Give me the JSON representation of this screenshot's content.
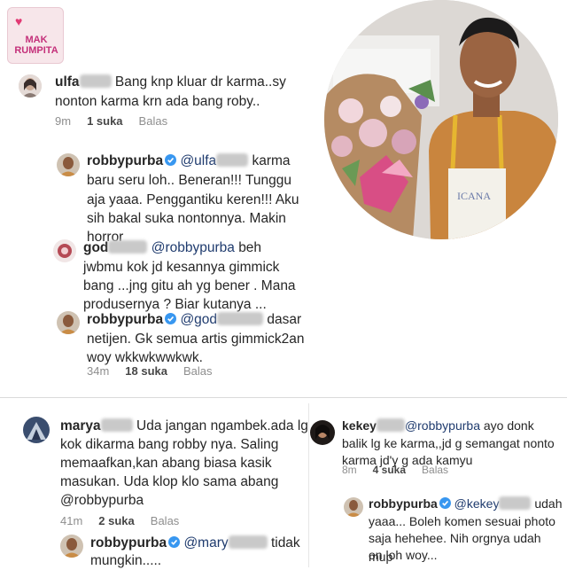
{
  "logo": {
    "text": "MAK RUMPITA"
  },
  "comments": {
    "ulfa": {
      "username": "ulfa",
      "text_1": "Bang knp kluar dr karma..sy",
      "text_2": "nonton karma krn ada bang roby..",
      "time": "9m",
      "likes": "1 suka",
      "reply": "Balas"
    },
    "robby1": {
      "username": "robbypurba",
      "mention": "@ulfa",
      "line1_tail": "karma",
      "line2": "baru seru loh.. Beneran!!! Tunggu",
      "line3": "aja yaaa. Penggantiku keren!!! Aku",
      "line4": "sih bakal suka nontonnya. Makin",
      "line5": "horror"
    },
    "god": {
      "username": "god",
      "mention": "@robbypurba",
      "line1_tail": "beh",
      "line2": "jwbmu kok jd kesannya gimmick",
      "line3": "bang ...jng gitu ah yg bener . Mana",
      "line4": "produsernya ? Biar kutanya ..."
    },
    "robby2": {
      "username": "robbypurba",
      "mention": "@god",
      "line1_tail": "dasar",
      "line2": "netijen. Gk semua artis gimmick2an",
      "line3": "woy wkkwkwwkwk.",
      "time": "34m",
      "likes": "18 suka",
      "reply": "Balas"
    },
    "marya": {
      "username": "marya",
      "text_1": "Uda jangan ngambek.ada lg",
      "line2": "kok dikarma bang robby nya. Saling",
      "line3": "memaafkan,kan abang biasa kasik",
      "line4": "masukan. Uda klop klo sama abang",
      "line5": "@robbypurba",
      "time": "41m",
      "likes": "2 suka",
      "reply": "Balas"
    },
    "robby3": {
      "username": "robbypurba",
      "mention": "@mary",
      "line1_tail": "tidak",
      "line2": "mungkin....."
    },
    "kekey": {
      "username": "kekey",
      "mention": "@robbypurba",
      "line1_tail": "ayo donk",
      "line2": "balik lg ke karma,,jd g semangat nonto",
      "line3": "karma jd'y g ada kamyu",
      "time": "8m",
      "likes": "4 suka",
      "reply": "Balas"
    },
    "robby4": {
      "username": "robbypurba",
      "mention": "@kekey",
      "line1_tail": "udah",
      "line2": "yaaa... Boleh komen sesuai photo",
      "line3": "saja hehehee. Nih orgnya udah mup",
      "line4": "on loh woy..."
    }
  },
  "colors": {
    "verified": "#3897f0",
    "meta": "#8e8e8e",
    "text": "#262626"
  }
}
